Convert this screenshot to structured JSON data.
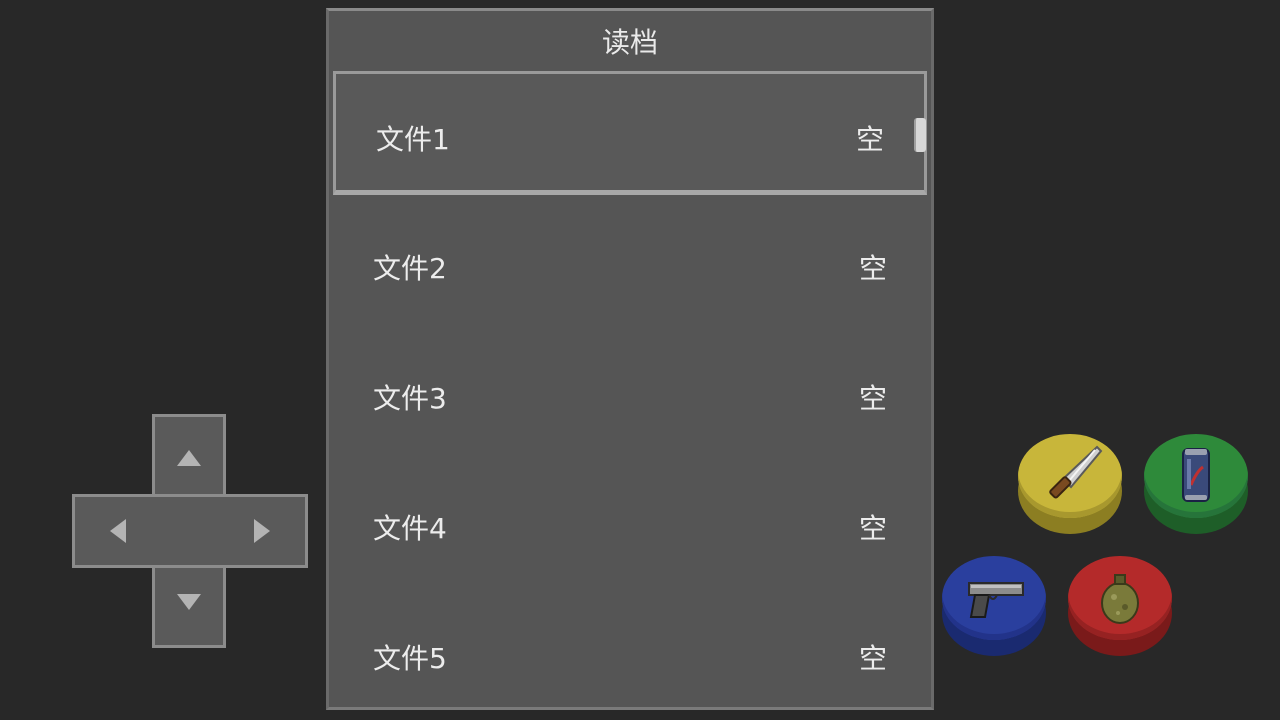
{
  "dialog": {
    "title": "读档",
    "slots": [
      {
        "name": "文件1",
        "status": "空"
      },
      {
        "name": "文件2",
        "status": "空"
      },
      {
        "name": "文件3",
        "status": "空"
      },
      {
        "name": "文件4",
        "status": "空"
      },
      {
        "name": "文件5",
        "status": "空"
      }
    ],
    "selected_index": 0
  },
  "dpad": {
    "up_icon": "up-arrow-icon",
    "down_icon": "down-arrow-icon",
    "left_icon": "left-arrow-icon",
    "right_icon": "right-arrow-icon"
  },
  "actions": [
    {
      "name": "knife",
      "icon": "knife-icon",
      "color": "#c8b63a"
    },
    {
      "name": "soda-can",
      "icon": "soda-can-icon",
      "color": "#2e8a3a"
    },
    {
      "name": "pistol",
      "icon": "pistol-icon",
      "color": "#2a3f9e"
    },
    {
      "name": "grenade",
      "icon": "grenade-icon",
      "color": "#b42a2a"
    }
  ],
  "colors": {
    "background": "#282828",
    "panel": "#555555",
    "text": "#ececec"
  }
}
